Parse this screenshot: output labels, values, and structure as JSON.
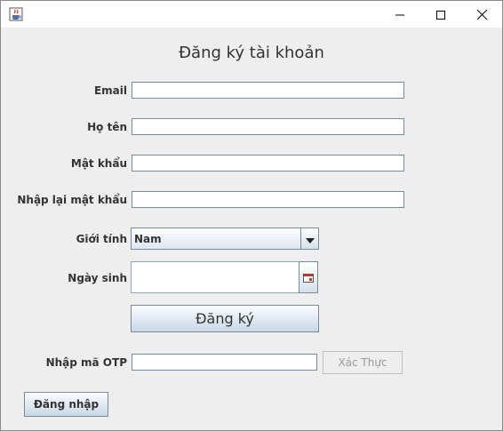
{
  "window": {
    "icons": {
      "app": "java-cup-icon",
      "minimize": "minimize-icon",
      "maximize": "maximize-icon",
      "close": "close-icon"
    }
  },
  "form": {
    "heading": "Đăng ký tài khoản",
    "email": {
      "label": "Email",
      "value": ""
    },
    "fullname": {
      "label": "Họ tên",
      "value": ""
    },
    "password": {
      "label": "Mật khẩu",
      "value": ""
    },
    "confirm_password": {
      "label": "Nhập lại mật khẩu",
      "value": ""
    },
    "gender": {
      "label": "Giới tính",
      "selected": "Nam"
    },
    "birthdate": {
      "label": "Ngày sinh",
      "value": "",
      "icon": "calendar-icon"
    },
    "register_label": "Đăng ký",
    "otp": {
      "label": "Nhập mã OTP",
      "value": ""
    },
    "verify_label": "Xác Thực",
    "login_label": "Đăng nhập"
  }
}
